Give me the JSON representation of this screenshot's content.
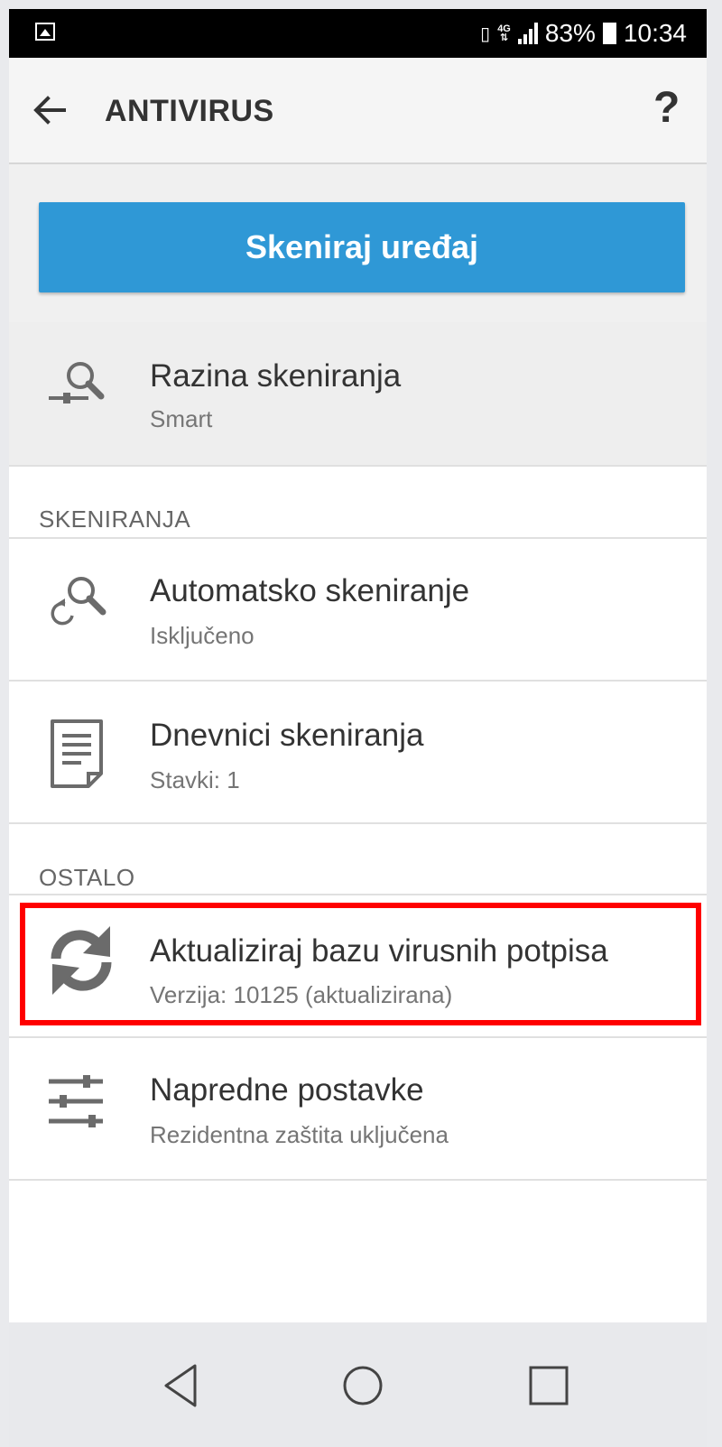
{
  "status_bar": {
    "network_label": "4G",
    "battery": "83%",
    "time": "10:34",
    "icons": [
      "image-icon",
      "vibrate-icon",
      "network-4g-icon",
      "signal-icon",
      "battery-icon"
    ]
  },
  "app_bar": {
    "title": "ANTIVIRUS",
    "back_icon": "arrow-left-icon",
    "help": "?"
  },
  "scan_button": {
    "label": "Skeniraj uređaj"
  },
  "scan_level": {
    "icon": "search-slider-icon",
    "title": "Razina skeniranja",
    "subtitle": "Smart"
  },
  "sections": {
    "scans_header": "SKENIRANJA",
    "other_header": "OSTALO"
  },
  "scans": [
    {
      "icon": "search-refresh-icon",
      "title": "Automatsko skeniranje",
      "subtitle": "Isključeno"
    },
    {
      "icon": "document-icon",
      "title": "Dnevnici skeniranja",
      "subtitle": "Stavki: 1"
    }
  ],
  "other": [
    {
      "icon": "sync-icon",
      "title": "Aktualiziraj bazu virusnih potpisa",
      "subtitle": "Verzija: 10125 (aktualizirana)",
      "highlighted": true
    },
    {
      "icon": "sliders-icon",
      "title": "Napredne postavke",
      "subtitle": "Rezidentna zaštita uključena"
    }
  ],
  "nav_bar": [
    "back-triangle-icon",
    "home-circle-icon",
    "recents-square-icon"
  ],
  "colors": {
    "accent": "#2f98d6",
    "highlight": "#ff0000",
    "status_bar": "#000000"
  }
}
